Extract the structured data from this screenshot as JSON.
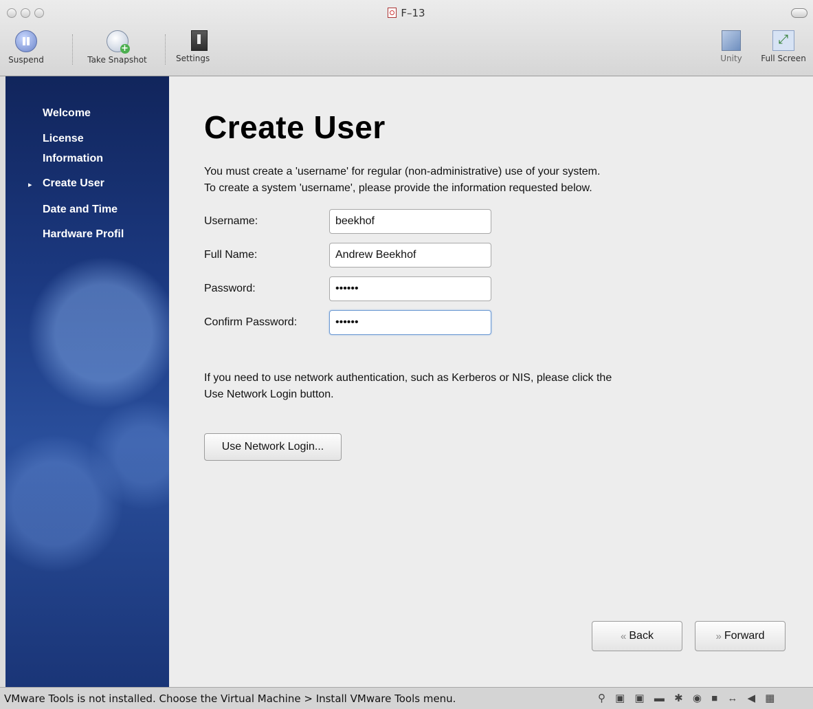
{
  "window": {
    "title": "F–13"
  },
  "toolbar": {
    "suspend": "Suspend",
    "take_snapshot": "Take Snapshot",
    "settings": "Settings",
    "unity": "Unity",
    "full_screen": "Full Screen"
  },
  "sidebar": {
    "items": [
      {
        "label": "Welcome"
      },
      {
        "label": "License"
      },
      {
        "label": "Information"
      },
      {
        "label": "Create User"
      },
      {
        "label": "Date and Time"
      },
      {
        "label": "Hardware Profil"
      }
    ]
  },
  "main": {
    "title": "Create User",
    "intro_line1": "You must create a 'username' for regular (non-administrative) use of your system.",
    "intro_line2": "To create a system 'username', please provide the information requested below.",
    "username_label": "Username:",
    "username_value": "beekhof",
    "fullname_label": "Full Name:",
    "fullname_value": "Andrew Beekhof",
    "password_label": "Password:",
    "password_value": "••••••",
    "confirm_label": "Confirm Password:",
    "confirm_value": "••••••",
    "network_line1": "If you need to use network authentication, such as Kerberos or NIS, please click the",
    "network_line2": "Use Network Login button.",
    "network_button": "Use Network Login...",
    "back_button": "Back",
    "forward_button": "Forward"
  },
  "statusbar": {
    "message": "VMware Tools is not installed. Choose the Virtual Machine > Install VMware Tools menu.",
    "icons": [
      "webcam-icon",
      "usb-icon",
      "usb-icon",
      "network-icon",
      "bluetooth-icon",
      "cd-icon",
      "hard-disk-icon",
      "network-adapter-icon",
      "sound-icon",
      "keyboard-icon"
    ]
  },
  "colors": {
    "sidebar": "#1c3a82",
    "background": "#ededed",
    "focus_border": "#6e9bd4"
  }
}
